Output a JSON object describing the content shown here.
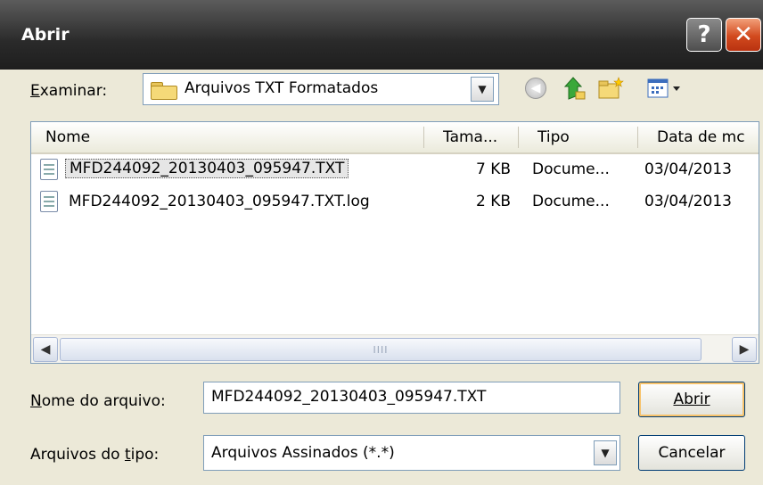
{
  "window": {
    "title": "Abrir",
    "help_glyph": "?",
    "close_glyph": "✕"
  },
  "toolbar": {
    "lookin_label": "Examinar:",
    "lookin_value": "Arquivos TXT Formatados"
  },
  "list": {
    "columns": [
      "Nome",
      "Tama...",
      "Tipo",
      "Data de mc"
    ],
    "rows": [
      {
        "name": "MFD244092_20130403_095947.TXT",
        "size": "7 KB",
        "type": "Docume...",
        "date": "03/04/2013",
        "selected": true
      },
      {
        "name": "MFD244092_20130403_095947.TXT.log",
        "size": "2 KB",
        "type": "Docume...",
        "date": "03/04/2013",
        "selected": false
      }
    ],
    "scroll_grip": "IIII"
  },
  "form": {
    "filename_label": "Nome do arquivo:",
    "filename_value": "MFD244092_20130403_095947.TXT",
    "filetype_label": "Arquivos do tipo:",
    "filetype_value": "Arquivos Assinados (*.*)",
    "open_button": "Abrir",
    "cancel_button": "Cancelar"
  },
  "colors": {
    "titlebar": "#2a2a2a",
    "close": "#d24a1e",
    "dialog_bg": "#ece9d8",
    "border": "#7f9db9"
  },
  "icons": [
    "folder-icon",
    "back-icon",
    "up-folder-icon",
    "new-folder-icon",
    "views-icon",
    "document-icon"
  ]
}
